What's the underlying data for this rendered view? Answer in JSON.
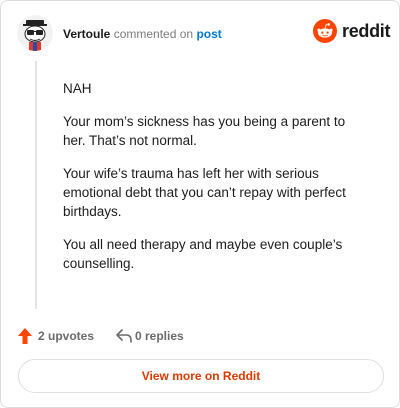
{
  "header": {
    "username": "Vertoule",
    "action": "commented on",
    "post_link": "post",
    "logo_text": "reddit"
  },
  "comment": {
    "paragraphs": [
      "NAH",
      "Your mom’s sickness has you being a parent to her. That’s not normal.",
      "Your wife’s trauma has left her with serious emotional debt that you can’t repay with perfect birthdays.",
      "You all need therapy and maybe even couple’s counselling."
    ]
  },
  "footer": {
    "upvotes": "2 upvotes",
    "replies": "0 replies"
  },
  "cta": {
    "label": "View more on Reddit"
  },
  "colors": {
    "brand_orange": "#ff4500",
    "link_blue": "#0079d3",
    "cta_text": "#d93a00"
  },
  "icons": {
    "upvote": "arrow-up-icon",
    "reply": "reply-arrow-icon",
    "logo": "reddit-snoo-icon"
  }
}
